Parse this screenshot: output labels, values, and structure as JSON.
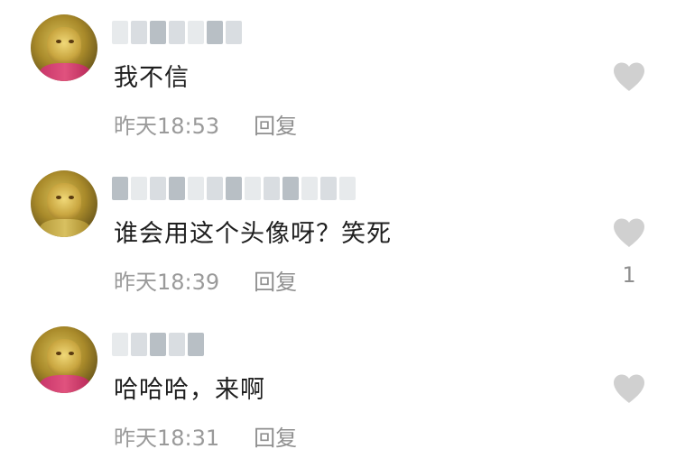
{
  "colors": {
    "text": "#1f1f1f",
    "meta": "#9a9a9a",
    "heart": "#d0d0d0",
    "blur": "#d9dde1"
  },
  "comments": [
    {
      "username": "",
      "avatar_icon": "monkey-king-avatar",
      "text": "我不信",
      "time": "昨天18:53",
      "reply_label": "回复",
      "likes": ""
    },
    {
      "username": "",
      "avatar_icon": "monkey-king-avatar",
      "text": "谁会用这个头像呀？笑死",
      "time": "昨天18:39",
      "reply_label": "回复",
      "likes": "1"
    },
    {
      "username": "",
      "avatar_icon": "monkey-king-avatar",
      "text": "哈哈哈，来啊",
      "time": "昨天18:31",
      "reply_label": "回复",
      "likes": ""
    }
  ]
}
